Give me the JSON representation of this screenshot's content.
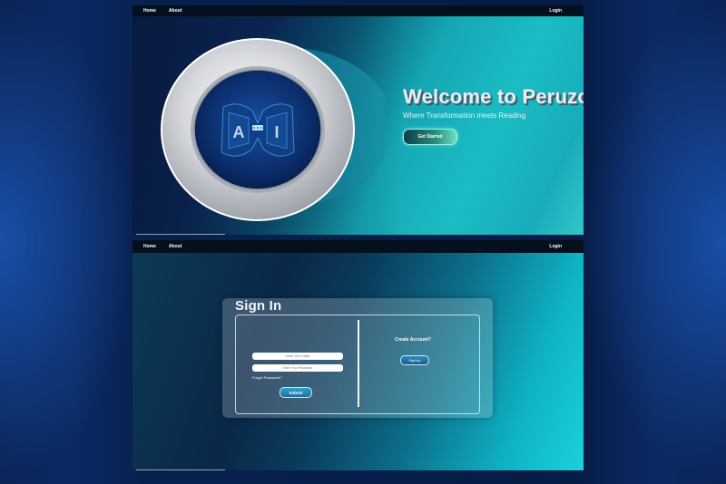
{
  "hero": {
    "nav": {
      "home": "Home",
      "about": "About",
      "login": "Login"
    },
    "headline": "Welcome to Peruzor",
    "subline": "Where Transformation meets Reading",
    "cta_label": "Get Started",
    "logo_letters": {
      "left": "A",
      "right": "I"
    }
  },
  "signin_page": {
    "nav": {
      "home": "Home",
      "about": "About",
      "login": "Login"
    },
    "title": "Sign In",
    "email_placeholder": "Enter Your EMail",
    "password_placeholder": "Enter Your Password",
    "forgot_label": "Forgot Password?",
    "submit_label": "Submit",
    "create_account_label": "Create Account?",
    "signup_label": "SignUp"
  },
  "colors": {
    "page_bg": "#0a2456",
    "navbar": "#05101e",
    "teal_accent": "#1bbcc3",
    "cta_green": "#6de0c4",
    "button_blue": "#2fa0d0"
  }
}
